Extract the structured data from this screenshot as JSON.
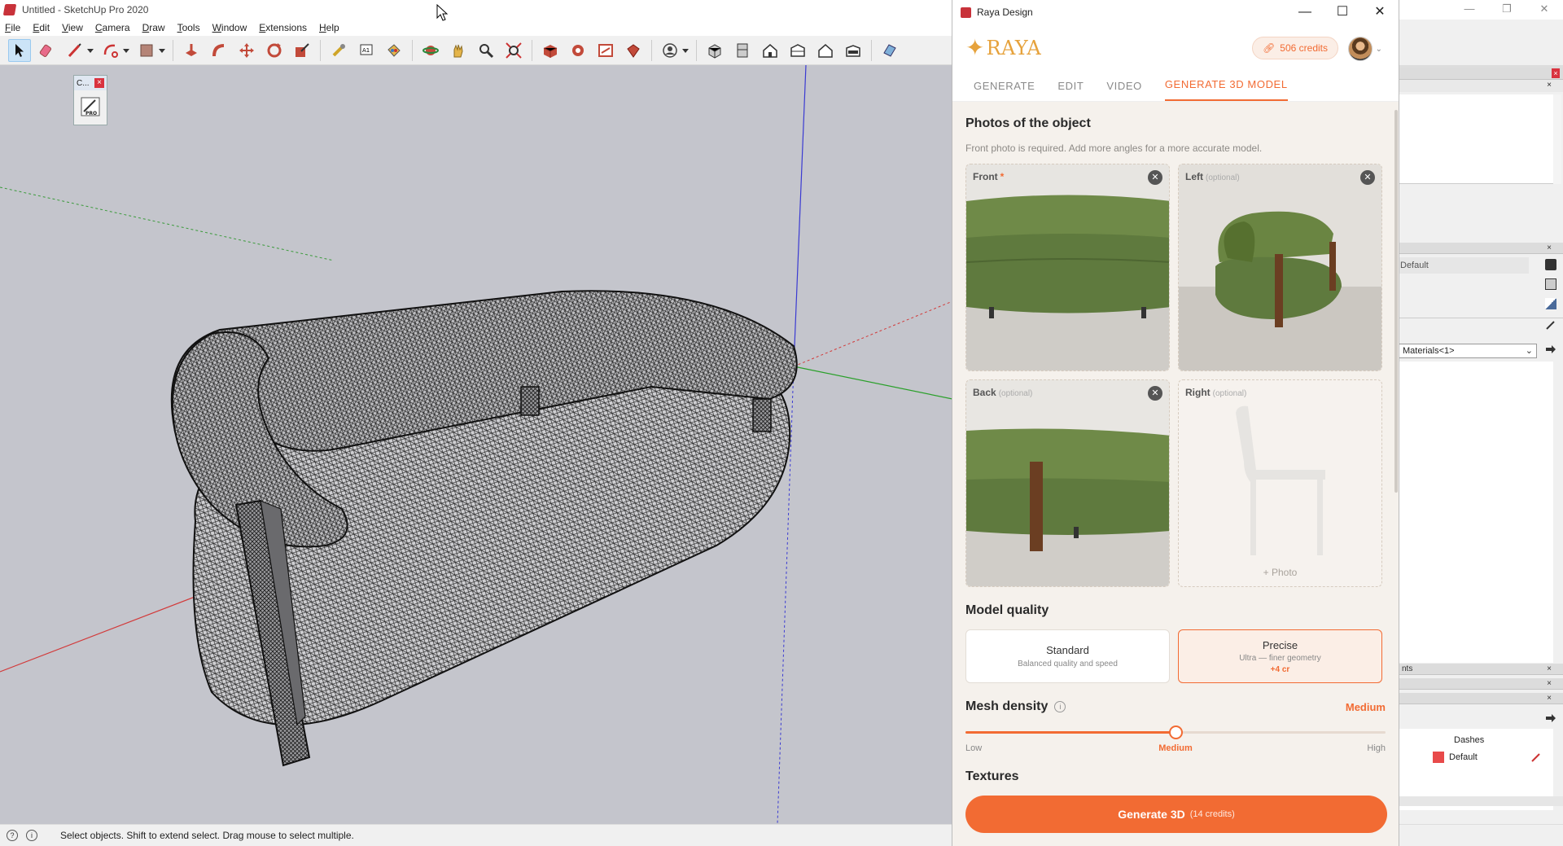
{
  "sketchup": {
    "title": "Untitled - SketchUp Pro 2020",
    "menu": [
      "File",
      "Edit",
      "View",
      "Camera",
      "Draw",
      "Tools",
      "Window",
      "Extensions",
      "Help"
    ],
    "ext_toolbar_title": "C...",
    "status_text": "Select objects. Shift to extend select. Drag mouse to select multiple.",
    "tray": {
      "material_field": "Default",
      "materials_select": "Materials<1>",
      "panel_label": "nts",
      "row_dashes": "Dashes",
      "row_default": "Default"
    }
  },
  "raya": {
    "window_title": "Raya Design",
    "logo_text": "RAYA",
    "credits": "506 credits",
    "tabs": [
      "GENERATE",
      "EDIT",
      "VIDEO",
      "GENERATE 3D MODEL"
    ],
    "active_tab": 3,
    "photos": {
      "title": "Photos of the object",
      "subtitle": "Front photo is required. Add more angles for a more accurate model.",
      "front": "Front",
      "required_mark": "*",
      "left": "Left",
      "back": "Back",
      "right": "Right",
      "optional": "(optional)",
      "add_photo": "+ Photo"
    },
    "quality": {
      "title": "Model quality",
      "standard_name": "Standard",
      "standard_desc": "Balanced quality and speed",
      "precise_name": "Precise",
      "precise_desc": "Ultra — finer geometry",
      "precise_extra": "+4 cr",
      "selected": "Precise"
    },
    "density": {
      "title": "Mesh density",
      "value": "Medium",
      "level": 0.5,
      "low": "Low",
      "mid": "Medium",
      "high": "High"
    },
    "textures_title": "Textures",
    "generate": {
      "label": "Generate 3D",
      "credits": "(14 credits)"
    }
  },
  "colors": {
    "accent": "#f26b33",
    "logo": "#e6a23c",
    "sofa_green": "#5f7a3e",
    "viewport_bg": "#c4c5cc"
  }
}
